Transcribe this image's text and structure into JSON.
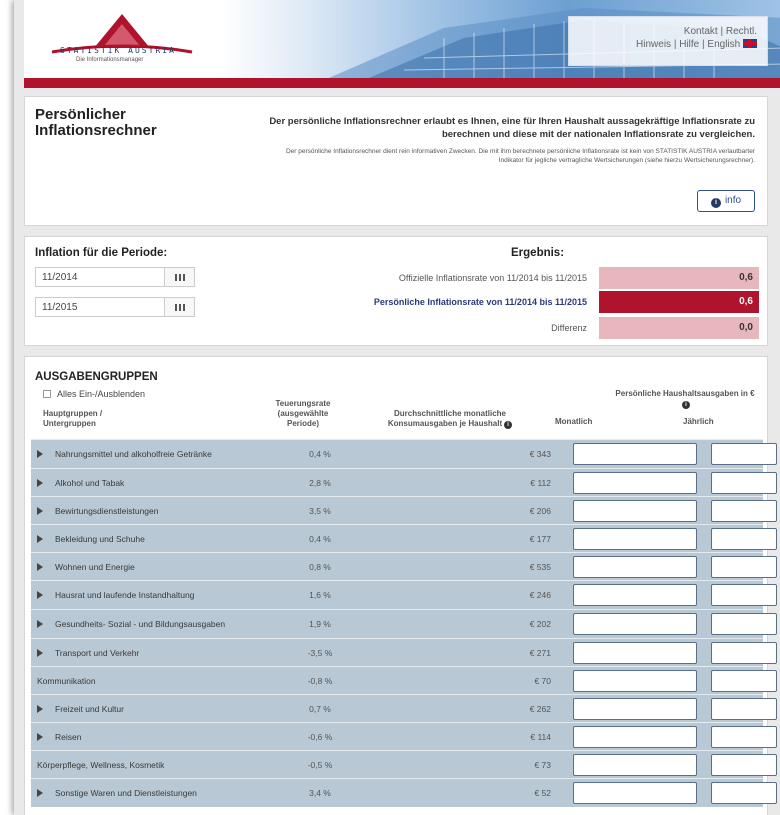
{
  "header": {
    "logo_text": "STATISTIK AUSTRIA",
    "logo_sub": "Die Informationsmanager",
    "nav": {
      "kontakt": "Kontakt",
      "rechtl": "Rechtl.",
      "hinweis": "Hinweis",
      "hilfe": "Hilfe",
      "english": "English",
      "sep": "|"
    }
  },
  "intro": {
    "title": "Persönlicher Inflationsrechner",
    "text": "Der persönliche Inflationsrechner erlaubt es Ihnen, eine für Ihren Haushalt aussagekräftige Inflationsrate zu berechnen und diese mit der nationalen Inflationsrate zu vergleichen.",
    "disclaimer": "Der persönliche Inflationsrechner dient rein informativen Zwecken. Die mit ihm berechnete persönliche Inflationsrate ist kein von STATISTIK AUSTRIA verlautbarter Indikator für jegliche vertragliche Wertsicherungen (siehe hierzu Wertsicherungsrechner).",
    "info_button": "info"
  },
  "period": {
    "heading": "Inflation für die Periode:",
    "from": "11/2014",
    "to": "11/2015"
  },
  "result": {
    "heading": "Ergebnis:",
    "official_label": "Offizielle Inflationsrate von 11/2014 bis 11/2015",
    "official_value": "0,6",
    "personal_label": "Persönliche Inflationsrate von 11/2014 bis 11/2015",
    "personal_value": "0,6",
    "diff_label": "Differenz",
    "diff_value": "0,0"
  },
  "groups": {
    "title": "AUSGABENGRUPPEN",
    "toggle_all": "Alles Ein-/Ausblenden",
    "col_main": "Hauptgruppen / Untergruppen",
    "col_rate": "Teuerungsrate (ausgewählte Periode)",
    "col_avg": "Durchschnittliche monatliche Konsumausgaben je Haushalt",
    "col_personal": "Persönliche Haushaltsausgaben in €",
    "col_month": "Monatlich",
    "col_year": "Jährlich",
    "rows": [
      {
        "name": "Nahrungsmittel und alkoholfreie Getränke",
        "rate": "0,4 %",
        "avg": "€ 343",
        "arrow": true
      },
      {
        "name": "Alkohol und Tabak",
        "rate": "2,8 %",
        "avg": "€ 112",
        "arrow": true
      },
      {
        "name": "Bewirtungsdienstleistungen",
        "rate": "3,5 %",
        "avg": "€ 206",
        "arrow": true
      },
      {
        "name": "Bekleidung und Schuhe",
        "rate": "0,4 %",
        "avg": "€ 177",
        "arrow": true
      },
      {
        "name": "Wohnen und Energie",
        "rate": "0,8 %",
        "avg": "€ 535",
        "arrow": true
      },
      {
        "name": "Hausrat und laufende Instandhaltung",
        "rate": "1,6 %",
        "avg": "€ 246",
        "arrow": true
      },
      {
        "name": "Gesundheits- Sozial - und Bildungsausgaben",
        "rate": "1,9 %",
        "avg": "€ 202",
        "arrow": true
      },
      {
        "name": "Transport und Verkehr",
        "rate": "-3,5 %",
        "avg": "€ 271",
        "arrow": true
      },
      {
        "name": "Kommunikation",
        "rate": "-0,8 %",
        "avg": "€ 70",
        "arrow": false
      },
      {
        "name": "Freizeit und Kultur",
        "rate": "0,7 %",
        "avg": "€ 262",
        "arrow": true
      },
      {
        "name": "Reisen",
        "rate": "-0,6 %",
        "avg": "€ 114",
        "arrow": true
      },
      {
        "name": "Körperpflege, Wellness, Kosmetik",
        "rate": "-0,5 %",
        "avg": "€ 73",
        "arrow": false
      },
      {
        "name": "Sonstige Waren und Dienstleistungen",
        "rate": "3,4 %",
        "avg": "€ 52",
        "arrow": true
      }
    ]
  },
  "colors": {
    "accent_red": "#b0132c",
    "row_bg": "#b8c8d4",
    "result_light": "#e8b7be",
    "link_blue": "#2d4f8a"
  }
}
